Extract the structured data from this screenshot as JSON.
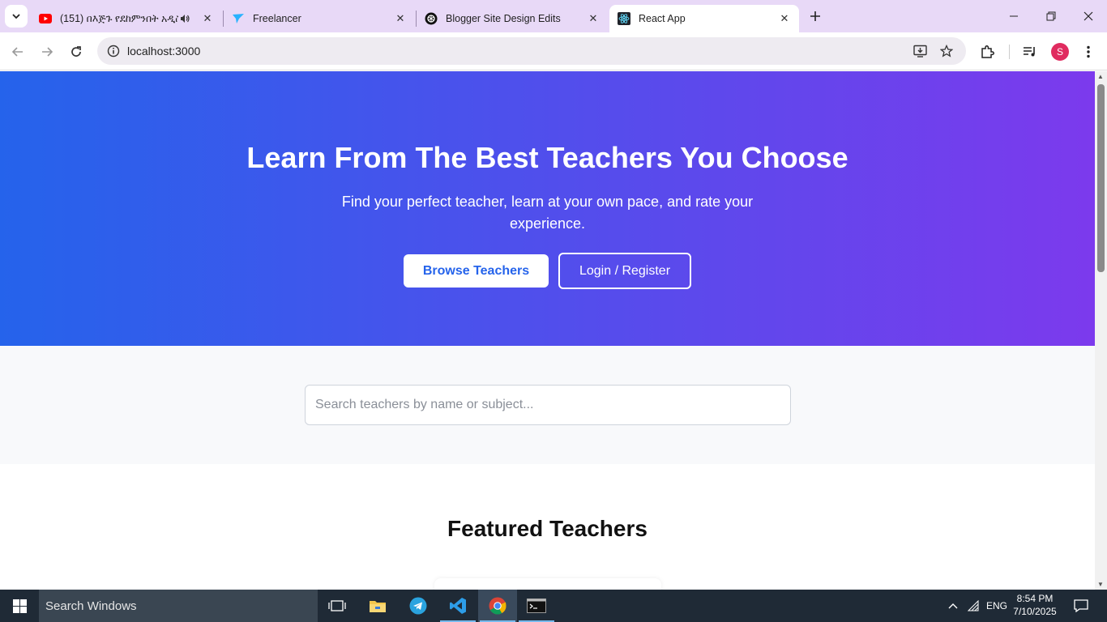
{
  "browser": {
    "tabs": [
      {
        "title": "(151) በእጅጉ የደከምንበት አዲስ",
        "favicon": "youtube-icon",
        "audible": true
      },
      {
        "title": "Freelancer",
        "favicon": "freelancer-icon"
      },
      {
        "title": "Blogger Site Design Edits",
        "favicon": "chatgpt-icon"
      },
      {
        "title": "React App",
        "favicon": "react-icon",
        "active": true
      }
    ],
    "url": "localhost:3000",
    "profile_initial": "S"
  },
  "hero": {
    "title": "Learn From The Best Teachers You Choose",
    "subtitle": "Find your perfect teacher, learn at your own pace, and rate your experience.",
    "browse_button": "Browse Teachers",
    "login_button": "Login / Register",
    "gradient_start": "#2563eb",
    "gradient_end": "#7c3aed"
  },
  "search": {
    "placeholder": "Search teachers by name or subject..."
  },
  "featured": {
    "title": "Featured Teachers"
  },
  "taskbar": {
    "search_placeholder": "Search Windows",
    "language": "ENG",
    "time": "8:54 PM",
    "date": "7/10/2025"
  }
}
